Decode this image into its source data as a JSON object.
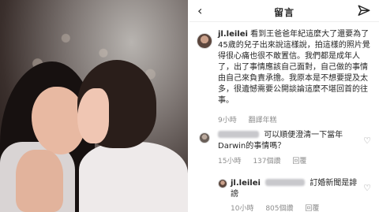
{
  "header": {
    "title": "留言"
  },
  "comments": [
    {
      "username": "jl.leilei",
      "text": "看到王爸爸年紀這麼大了還要為了45歲的兒子出來說這樣說，拍這樣的照片覺得很心痛也很不敢置信。我們都是成年人了，出了事情應該自己面對，自己做的事情由自己來負責承擔。我原本是不想要提及太多，很遺憾需要公開談論這麼不堪回首的往事。",
      "time": "9小時",
      "action": "翻譯年糕"
    },
    {
      "username": "",
      "text": "可以順便澄清一下當年Darwin的事情嗎？",
      "time": "15小時",
      "likes": "137個讚",
      "reply": "回覆"
    },
    {
      "username": "jl.leilei",
      "mention": "",
      "text": "訂婚新聞是誹謗",
      "time": "10小時",
      "likes": "805個讚",
      "reply": "回覆"
    }
  ],
  "icons": [
    "back-icon",
    "send-icon",
    "heart-icon"
  ],
  "colors": {
    "text": "#262626",
    "meta": "#8e8e8e",
    "divider": "#efefef"
  }
}
